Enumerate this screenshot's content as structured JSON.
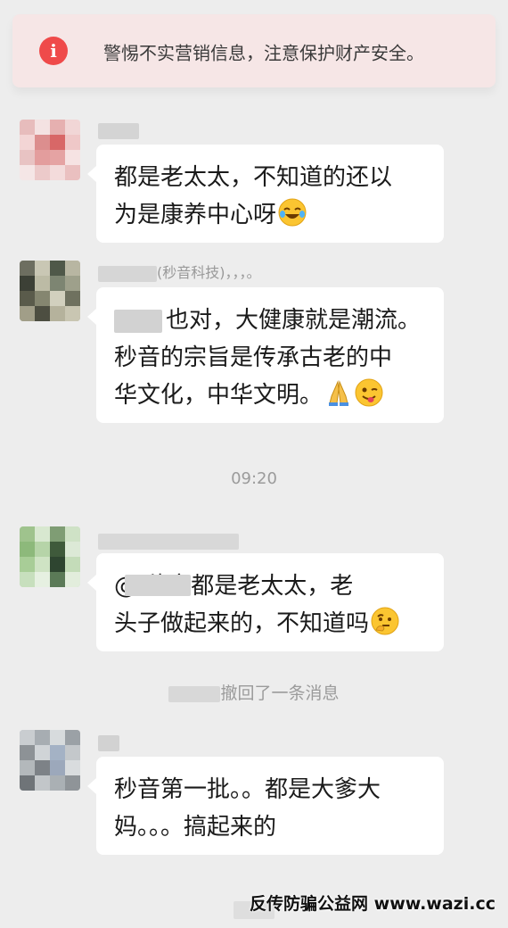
{
  "banner": {
    "icon": "alert-icon",
    "icon_glyph": "i",
    "text": "警惕不实营销信息，注意保护财产安全。"
  },
  "messages": [
    {
      "name_visible": "",
      "lines": [
        "都是老太太，不知道的还以",
        "为是康养中心呀"
      ],
      "emoji": [
        "laughing-crying-emoji"
      ]
    },
    {
      "name_visible": "(秒音科技)，，，。",
      "lines": [
        "也对，大健康就是潮流。",
        "秒音的宗旨是传承古老的中",
        "华文化，中华文明。"
      ],
      "emoji": [
        "praying-hands-emoji",
        "winking-tongue-emoji"
      ]
    },
    {
      "name_visible": "",
      "lines": [
        "@ 秒音都是老太太，老",
        "头子做起来的，不知道吗"
      ],
      "emoji": [
        "thinking-emoji"
      ]
    },
    {
      "name_visible": "",
      "lines": [
        "秒音第一批。。都是大爹大",
        "妈。。。搞起来的"
      ],
      "emoji": []
    }
  ],
  "time_label": "09:20",
  "recall_notice": "撤回了一条消息",
  "watermark": "反传防骗公益网 www.wazi.cc",
  "colors": {
    "background": "#ededed",
    "bubble": "#ffffff",
    "alert_red": "#ef4a4a",
    "banner_bg": "#f6e6e6",
    "meta_text": "#9b9b9b"
  }
}
